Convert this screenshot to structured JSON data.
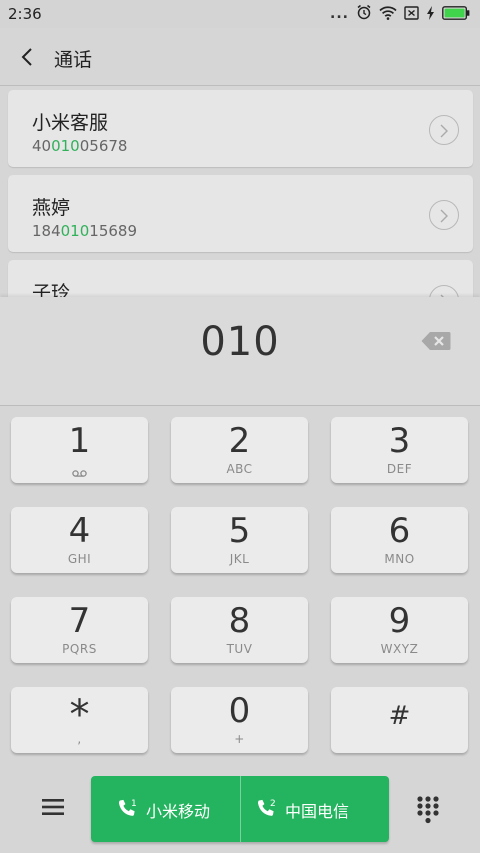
{
  "status_bar": {
    "time": "2:36",
    "more": "..."
  },
  "header": {
    "title": "通话"
  },
  "results": [
    {
      "name": "小米客服",
      "number_pre": "40",
      "number_match": "010",
      "number_post": "05678"
    },
    {
      "name": "燕婷",
      "number_pre": "184",
      "number_match": "010",
      "number_post": "15689"
    },
    {
      "name": "子玲"
    }
  ],
  "dial": {
    "value": "010"
  },
  "keys": [
    {
      "digit": "1",
      "letters": ""
    },
    {
      "digit": "2",
      "letters": "ABC"
    },
    {
      "digit": "3",
      "letters": "DEF"
    },
    {
      "digit": "4",
      "letters": "GHI"
    },
    {
      "digit": "5",
      "letters": "JKL"
    },
    {
      "digit": "6",
      "letters": "MNO"
    },
    {
      "digit": "7",
      "letters": "PQRS"
    },
    {
      "digit": "8",
      "letters": "TUV"
    },
    {
      "digit": "9",
      "letters": "WXYZ"
    },
    {
      "digit": "*",
      "letters": ","
    },
    {
      "digit": "0",
      "letters": "+"
    },
    {
      "digit": "#",
      "letters": ""
    }
  ],
  "call_buttons": {
    "sim1": {
      "slot": "1",
      "label": "小米移动"
    },
    "sim2": {
      "slot": "2",
      "label": "中国电信"
    }
  },
  "colors": {
    "accent_green": "#24b35f",
    "match_green": "#30b15a",
    "battery_green": "#3fd44b"
  },
  "icons": [
    "signal-dots-icon",
    "alarm-icon",
    "wifi-icon",
    "no-sim-icon",
    "charging-icon",
    "battery-icon",
    "back-icon",
    "chevron-right-icon",
    "backspace-icon",
    "voicemail-icon",
    "menu-icon",
    "phone-icon",
    "dialpad-icon"
  ]
}
